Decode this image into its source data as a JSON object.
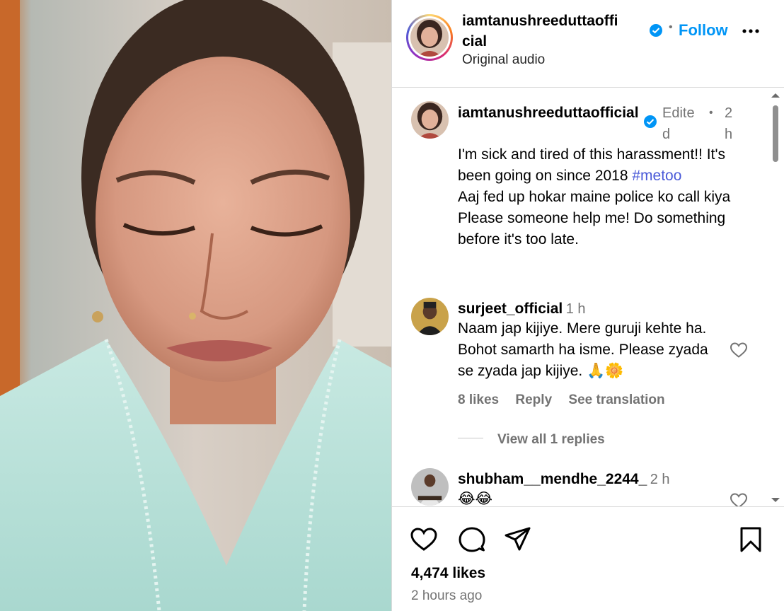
{
  "post": {
    "username": "iamtanushreeduttaofficial",
    "follow_label": "Follow",
    "audio": "Original audio",
    "likes": "4,474 likes",
    "time": "2 hours ago",
    "separator": "•"
  },
  "caption": {
    "username": "iamtanushreeduttaofficial",
    "edited": "Edited",
    "time": "2h",
    "text_1": "I'm sick and tired of this harassment!! It's been going on since 2018 ",
    "hashtag": "#metoo",
    "text_2": "Aaj fed up hokar maine police ko call kiya",
    "text_3": "Please someone help me! Do something before it's too late."
  },
  "comments": [
    {
      "username": "surjeet_official",
      "time": "1 h",
      "text": "Naam jap kijiye. Mere guruji kehte ha. Bohot samarth ha isme. Please zyada se zyada jap kijiye. 🙏🌼",
      "likes": "8 likes",
      "reply": "Reply",
      "translate": "See translation",
      "view_replies": "View all 1 replies"
    },
    {
      "username": "shubham__mendhe_2244_",
      "time": "2 h",
      "text": "😂😂"
    }
  ],
  "icons": {
    "verified": "verified-badge-icon",
    "more": "more-options-icon",
    "like": "heart-icon",
    "comment": "comment-icon",
    "share": "share-icon",
    "save": "bookmark-icon"
  },
  "colors": {
    "accent": "#0095f6",
    "hashtag": "#4a5ad8",
    "muted": "#737373",
    "border": "#dbdbdb"
  }
}
